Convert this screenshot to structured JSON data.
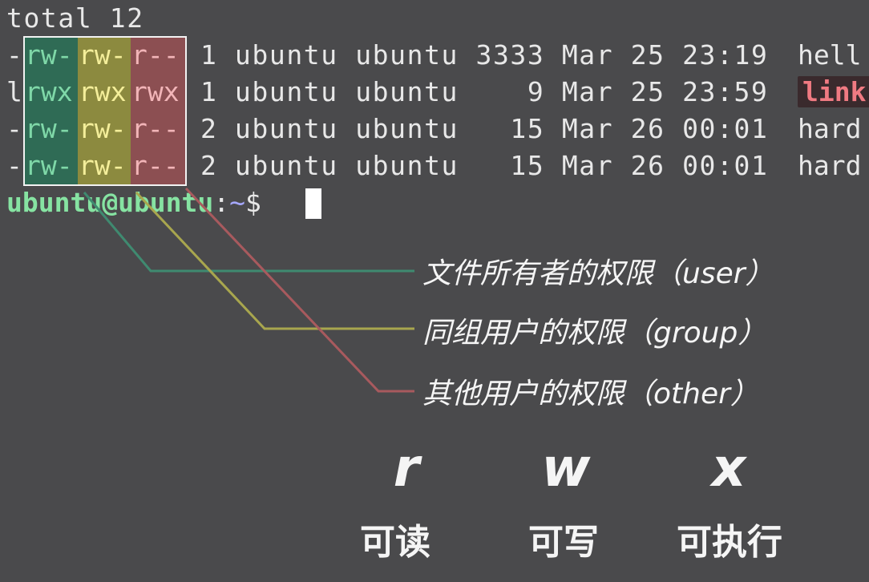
{
  "terminal": {
    "total_line": "total 12",
    "rows": [
      {
        "prefix": "-",
        "user": "rw-",
        "group": "rw-",
        "other": "r--",
        "rest": "1 ubuntu ubuntu 3333 Mar 25 23:19",
        "name": "hell",
        "is_link": false
      },
      {
        "prefix": "l",
        "user": "rwx",
        "group": "rwx",
        "other": "rwx",
        "rest": "1 ubuntu ubuntu    9 Mar 25 23:59",
        "name": "link",
        "is_link": true
      },
      {
        "prefix": "-",
        "user": "rw-",
        "group": "rw-",
        "other": "r--",
        "rest": "2 ubuntu ubuntu   15 Mar 26 00:01",
        "name": "hard",
        "is_link": false
      },
      {
        "prefix": "-",
        "user": "rw-",
        "group": "rw-",
        "other": "r--",
        "rest": "2 ubuntu ubuntu   15 Mar 26 00:01",
        "name": "hard",
        "is_link": false
      }
    ],
    "prompt": {
      "user_host": "ubuntu@ubuntu",
      "colon": ":",
      "path": "~",
      "symbol": "$ "
    }
  },
  "annotations": {
    "user": "文件所有者的权限（user）",
    "group": "同组用户的权限（group）",
    "other": "其他用户的权限（other）"
  },
  "permissions": {
    "read": {
      "letter": "r",
      "label": "可读"
    },
    "write": {
      "letter": "w",
      "label": "可写"
    },
    "execute": {
      "letter": "x",
      "label": "可执行"
    }
  },
  "colors": {
    "background": "#4a4a4c",
    "user_column": "#2f6b55",
    "group_column": "#8c8a3f",
    "other_column": "#8c4f52",
    "user_line": "#3f8a70",
    "group_line": "#a8a64e",
    "other_line": "#a85a5e",
    "prompt_user": "#86e3a2",
    "prompt_path": "#a6a8ff",
    "link_name": "#f07a82"
  }
}
